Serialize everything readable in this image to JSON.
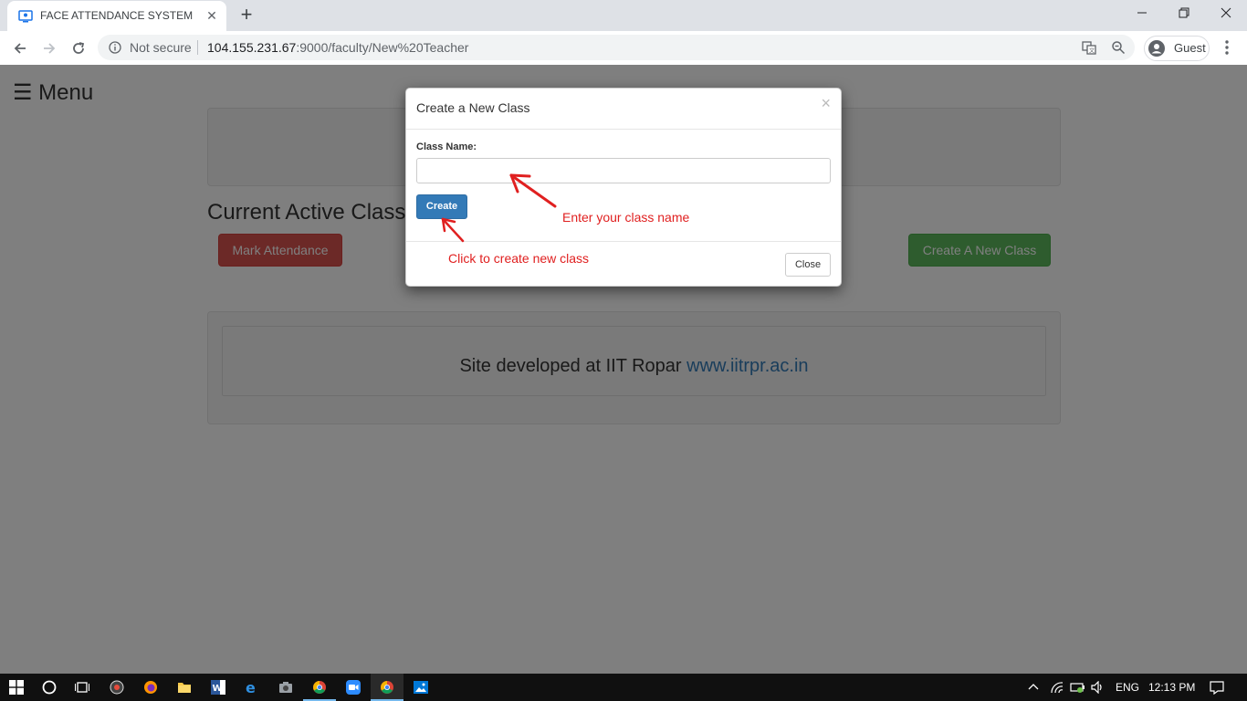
{
  "browser": {
    "tab_title": "FACE ATTENDANCE SYSTEM",
    "security_label": "Not secure",
    "url_host": "104.155.231.67",
    "url_rest": ":9000/faculty/New%20Teacher",
    "profile_label": "Guest"
  },
  "page": {
    "menu_label": "☰ Menu",
    "section_title": "Current Active Class",
    "mark_attendance_label": "Mark Attendance",
    "create_class_label": "Create A New Class",
    "footer_text": "Site developed at IIT Ropar",
    "footer_link": "www.iitrpr.ac.in"
  },
  "modal": {
    "title": "Create a New Class",
    "close_x": "×",
    "field_label": "Class Name:",
    "field_value": "",
    "create_label": "Create",
    "close_label": "Close"
  },
  "annotations": {
    "input_hint": "Enter your class name",
    "button_hint": "Click to create new class"
  },
  "taskbar": {
    "language": "ENG",
    "time": "12:13 PM",
    "apps": [
      "windows-start",
      "cortana-search",
      "task-view",
      "media-player",
      "firefox",
      "file-explorer",
      "word",
      "edge",
      "camera",
      "chrome",
      "zoom",
      "chrome-active",
      "photos"
    ]
  },
  "colors": {
    "danger": "#d9534f",
    "success": "#5cb85c",
    "primary": "#337ab7",
    "annotation_red": "#e02020"
  }
}
